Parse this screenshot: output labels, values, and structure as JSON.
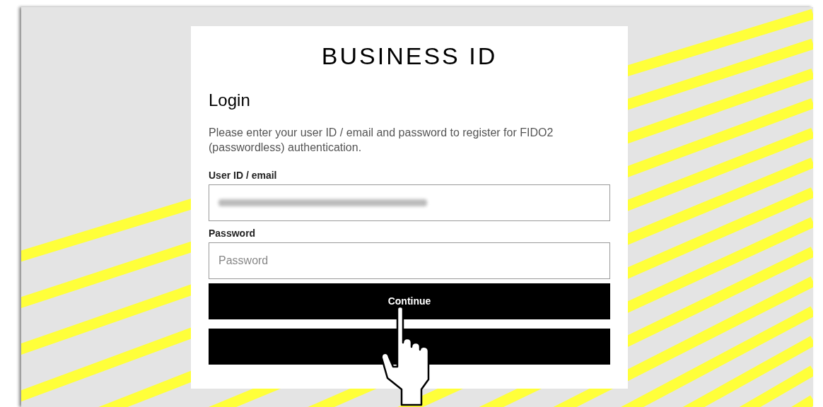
{
  "brand": "BUSINESS ID",
  "heading": "Login",
  "intro": "Please enter your user ID / email and password to register for FIDO2 (passwordless) authentication.",
  "fields": [
    {
      "label": "User ID / email",
      "kind": "blurred"
    },
    {
      "label": "Password",
      "kind": "empty",
      "placeholder": "Password"
    }
  ],
  "buttons": [
    {
      "label": "Continue",
      "kind": "text"
    },
    {
      "kind": "covered"
    }
  ]
}
